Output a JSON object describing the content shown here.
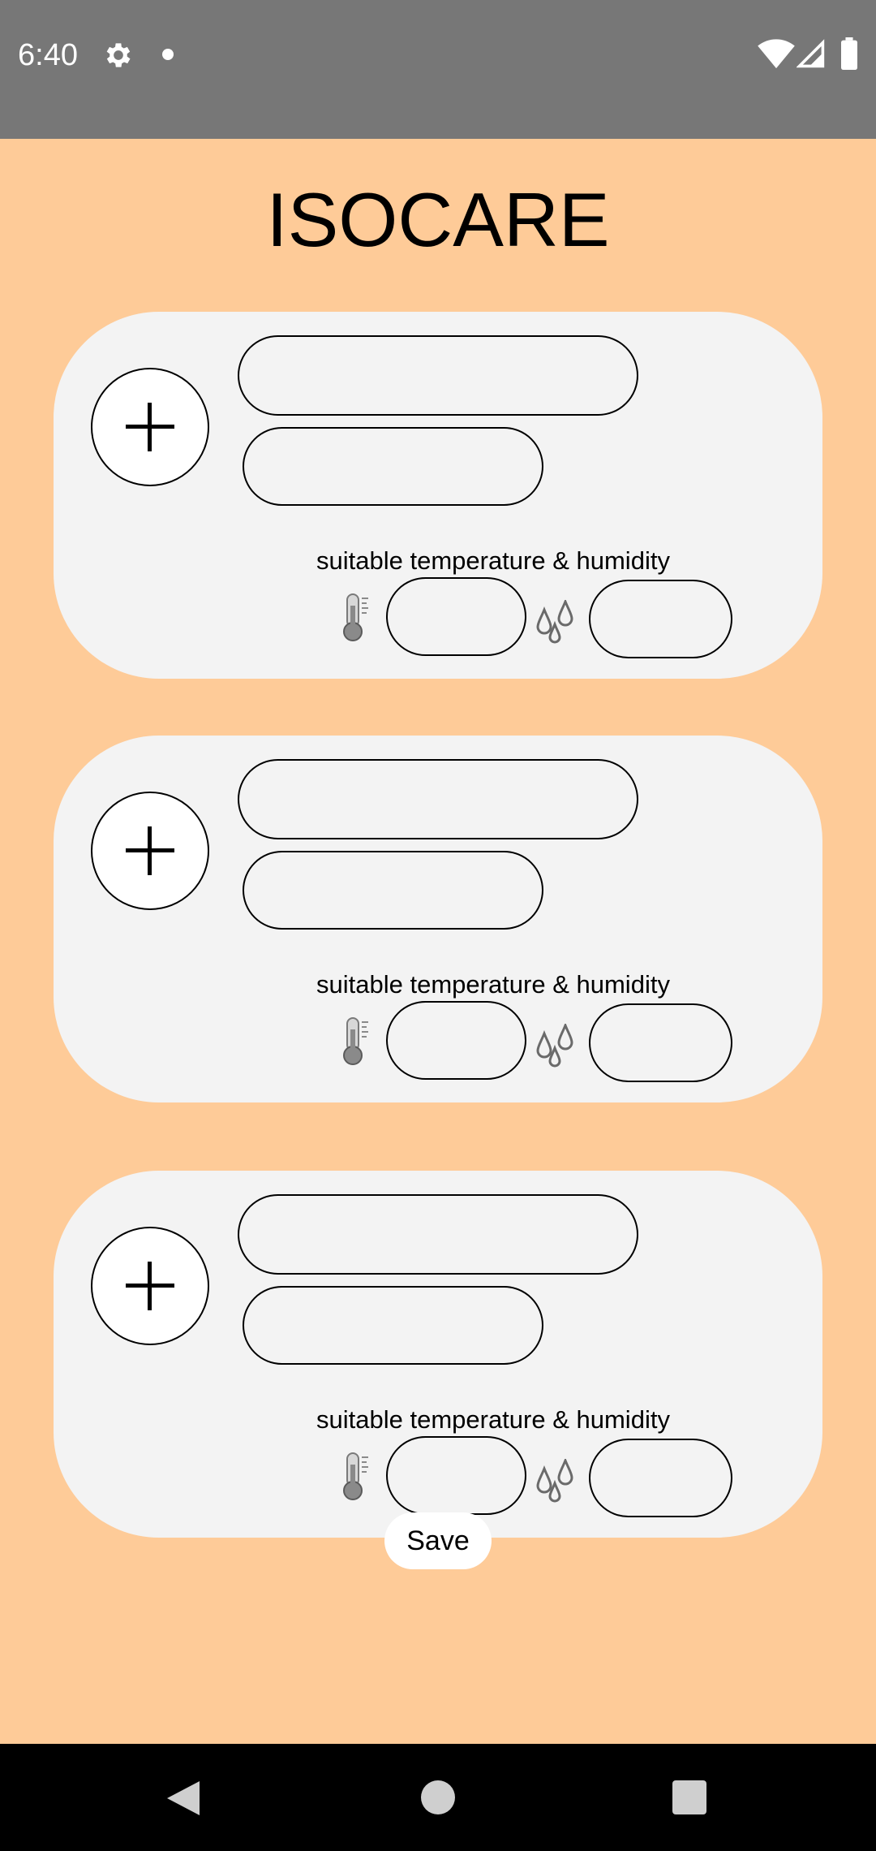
{
  "status_bar": {
    "time": "6:40",
    "icons": [
      "gear-icon",
      "notification-dot-icon",
      "wifi-icon",
      "cell-signal-icon",
      "battery-icon"
    ]
  },
  "app": {
    "title": "ISOCARE",
    "background_color": "#fecb98",
    "card_color": "#f3f3f3"
  },
  "cards": [
    {
      "add_icon": "plus-icon",
      "name_value": "",
      "detail_value": "",
      "range_label": "suitable temperature & humidity",
      "temperature_icon": "thermometer-icon",
      "temperature_value": "",
      "humidity_icon": "water-drops-icon",
      "humidity_value": ""
    },
    {
      "add_icon": "plus-icon",
      "name_value": "",
      "detail_value": "",
      "range_label": "suitable temperature & humidity",
      "temperature_icon": "thermometer-icon",
      "temperature_value": "",
      "humidity_icon": "water-drops-icon",
      "humidity_value": ""
    },
    {
      "add_icon": "plus-icon",
      "name_value": "",
      "detail_value": "",
      "range_label": "suitable temperature & humidity",
      "temperature_icon": "thermometer-icon",
      "temperature_value": "",
      "humidity_icon": "water-drops-icon",
      "humidity_value": ""
    }
  ],
  "save_label": "Save",
  "nav_bar": {
    "buttons": [
      "back-icon",
      "home-icon",
      "recents-icon"
    ]
  }
}
